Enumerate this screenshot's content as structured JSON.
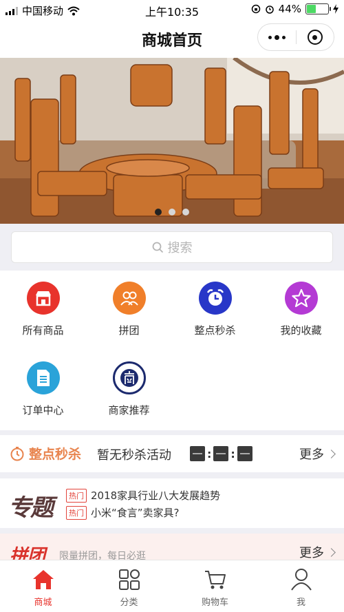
{
  "status": {
    "carrier": "中国移动",
    "time": "上午10:35",
    "battery": "44%",
    "battery_level": 0.44
  },
  "nav": {
    "title": "商城首页"
  },
  "banner": {
    "slides": 3,
    "active": 0
  },
  "search": {
    "placeholder": "搜索"
  },
  "categories": [
    {
      "label": "所有商品",
      "icon": "shop-icon",
      "color": "#e8332c"
    },
    {
      "label": "拼团",
      "icon": "group-icon",
      "color": "#f07f2a"
    },
    {
      "label": "整点秒杀",
      "icon": "alarm-clock-icon",
      "color": "#2837c8"
    },
    {
      "label": "我的收藏",
      "icon": "star-icon",
      "color": "#b43ad4"
    },
    {
      "label": "订单中心",
      "icon": "document-icon",
      "color": "#2aa3d9"
    },
    {
      "label": "商家推荐",
      "icon": "merchant-icon",
      "color": "#1c2a6e"
    }
  ],
  "flash_sale": {
    "title": "整点秒杀",
    "message": "暂无秒杀活动",
    "more": "更多"
  },
  "topics": {
    "logo": "专题",
    "items": [
      {
        "tag": "热门",
        "text": "2018家具行业八大发展趋势"
      },
      {
        "tag": "热门",
        "text": "小米“食言”卖家具?"
      }
    ]
  },
  "group_buy": {
    "logo": "拼团",
    "desc": "限量拼团，每日必逛",
    "more": "更多"
  },
  "tabs": [
    {
      "label": "商城",
      "icon": "home-icon",
      "active": true
    },
    {
      "label": "分类",
      "icon": "category-icon",
      "active": false
    },
    {
      "label": "购物车",
      "icon": "cart-icon",
      "active": false
    },
    {
      "label": "我",
      "icon": "profile-icon",
      "active": false
    }
  ]
}
